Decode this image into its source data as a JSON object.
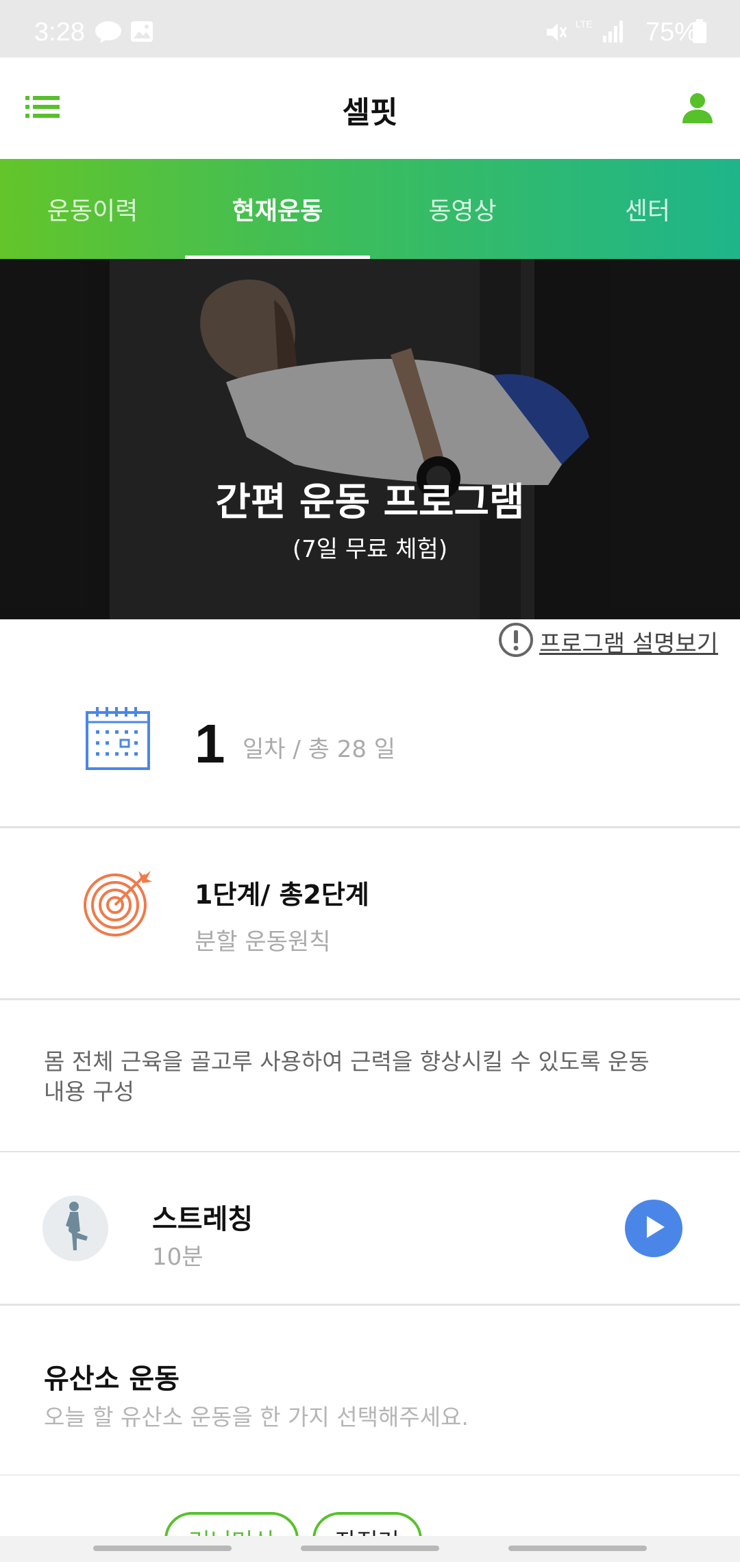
{
  "status_bar": {
    "time": "3:28",
    "battery": "75%",
    "network": "LTE",
    "icons": [
      "chat-bubble-icon",
      "gallery-icon",
      "vibrate-off-icon",
      "signal-icon",
      "battery-icon"
    ]
  },
  "app_bar": {
    "title": "셀핏",
    "menu_icon": "list-menu-icon",
    "profile_icon": "person-icon",
    "accent_color": "#57c12c"
  },
  "tabs": [
    {
      "label": "운동이력",
      "active": false
    },
    {
      "label": "현재운동",
      "active": true
    },
    {
      "label": "동영상",
      "active": false
    },
    {
      "label": "센터",
      "active": false
    }
  ],
  "hero": {
    "title": "간편 운동 프로그램",
    "subtitle": "(7일 무료 체험)"
  },
  "program_link": {
    "label": "프로그램 설명보기",
    "icon": "exclamation-circle-icon"
  },
  "day": {
    "current": "1",
    "total_text": "일차 / 총 28 일",
    "icon": "calendar-icon"
  },
  "stage": {
    "title": "1단계/ 총2단계",
    "subtitle": "분할 운동원칙",
    "icon": "target-arrow-icon"
  },
  "description": "몸 전체 근육을 골고루 사용하여 근력을 향상시킬 수 있도록 운동내용 구성",
  "stretching": {
    "name": "스트레칭",
    "duration": "10분",
    "icon": "play-icon"
  },
  "cardio": {
    "title": "유산소 운동",
    "subtitle": "오늘 할 유산소 운동을 한 가지 선택해주세요.",
    "chips": [
      "러닝머신",
      "자전거"
    ]
  },
  "colors": {
    "green": "#57c12c",
    "gradient_start": "#63c52a",
    "gradient_end": "#1fb58a",
    "blue": "#4a86e8",
    "orange": "#ef7a4a"
  }
}
